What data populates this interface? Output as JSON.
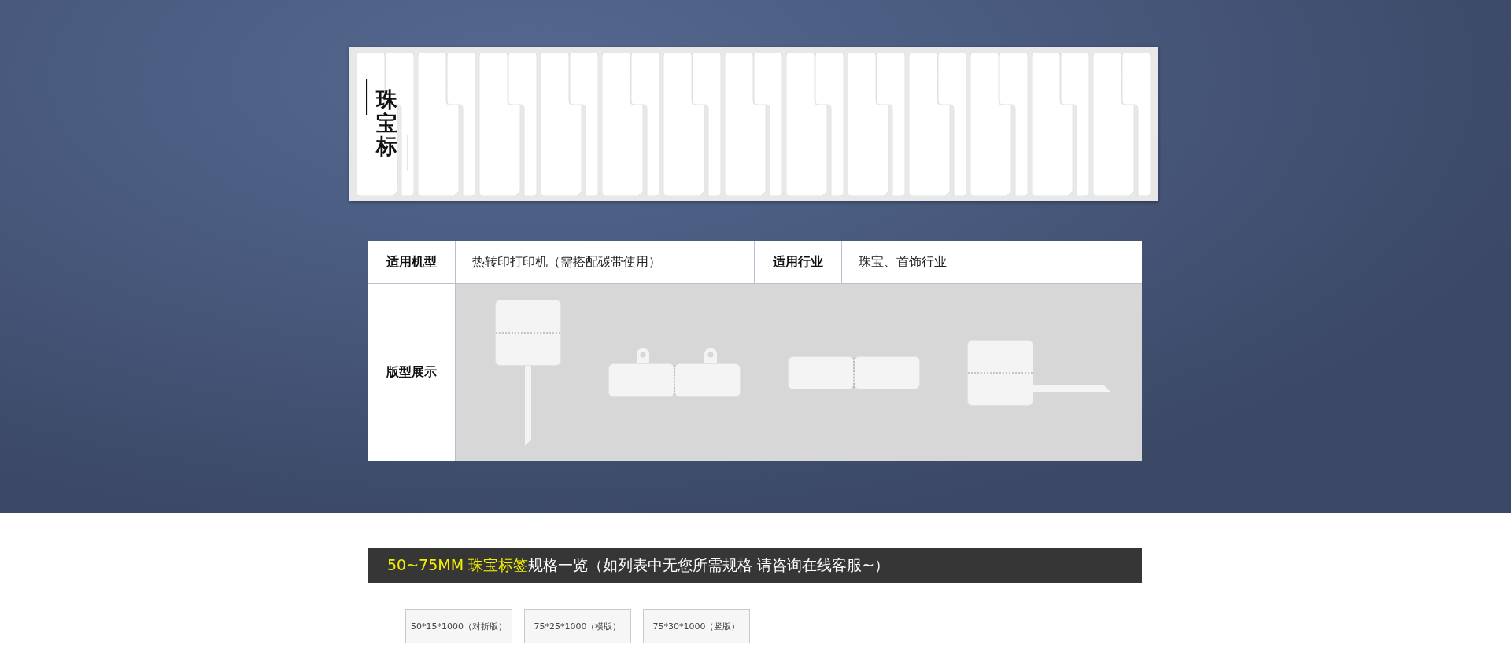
{
  "banner": {
    "title": "珠宝标"
  },
  "specs": {
    "header": [
      {
        "label": "适用机型",
        "value": "热转印打印机（需搭配碳带使用）"
      },
      {
        "label": "适用行业",
        "value": "珠宝、首饰行业"
      }
    ],
    "layouts_label": "版型展示",
    "layouts": [
      {
        "kind": "flag"
      },
      {
        "kind": "hang"
      },
      {
        "kind": "pair"
      },
      {
        "kind": "tail"
      }
    ]
  },
  "size_bar": {
    "highlight": "50~75MM 珠宝标签",
    "text": "规格一览（如列表中无您所需规格 请咨询在线客服~）"
  },
  "sizes": [
    "50*15*1000（对折版）",
    "75*25*1000（横版）",
    "75*30*1000（竖版）"
  ]
}
